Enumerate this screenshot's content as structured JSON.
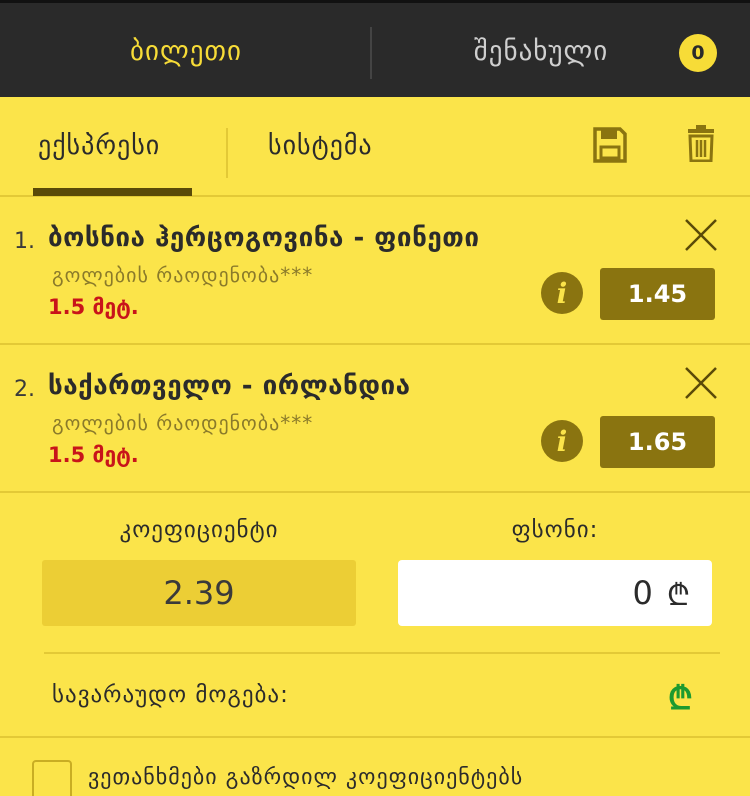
{
  "header": {
    "tab_ticket": "ბილეთი",
    "tab_saved": "შენახული",
    "saved_count": "0"
  },
  "subtabs": {
    "express": "ექსპრესი",
    "system": "სისტემა"
  },
  "icons": {
    "save": "floppy-disk-icon",
    "delete": "trash-icon",
    "close": "close-icon",
    "info": "info-icon",
    "currency": "lari-icon"
  },
  "bets": [
    {
      "num": "1.",
      "title": "ბოსნია ჰერცოგოვინა - ფინეთი",
      "market": "გოლების რაოდენობა***",
      "pick": "1.5 მეტ.",
      "odds": "1.45",
      "info": "i"
    },
    {
      "num": "2.",
      "title": "საქართველო - ირლანდია",
      "market": "გოლების რაოდენობა***",
      "pick": "1.5 მეტ.",
      "odds": "1.65",
      "info": "i"
    }
  ],
  "summary": {
    "coef_label": "კოეფიციენტი",
    "coef_value": "2.39",
    "stake_label": "ფსონი:",
    "stake_value": "0",
    "currency_symbol": "₾",
    "win_label": "სავარაუდო მოგება:",
    "win_value": "₾"
  },
  "agree": {
    "label": "ვეთანხმები გაზრდილ კოეფიციენტებს"
  },
  "colors": {
    "background": "#fbe44a",
    "topbar": "#2a2a2a",
    "accent": "#f7dc37",
    "odds_box": "#8a7410",
    "pick_red": "#c8141a",
    "win_green": "#1d9a2f"
  }
}
